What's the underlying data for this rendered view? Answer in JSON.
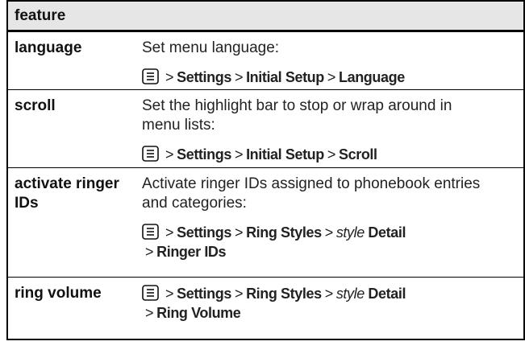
{
  "header": {
    "label": "feature"
  },
  "rows": [
    {
      "label": "language",
      "description": "Set menu language:",
      "path": [
        {
          "kind": "icon",
          "text": "menu-key-icon"
        },
        {
          "kind": "sep",
          "text": ">"
        },
        {
          "kind": "item",
          "text": "Settings"
        },
        {
          "kind": "sep",
          "text": ">"
        },
        {
          "kind": "item",
          "text": "Initial Setup"
        },
        {
          "kind": "sep",
          "text": ">"
        },
        {
          "kind": "item",
          "text": "Language"
        }
      ]
    },
    {
      "label": "scroll",
      "description": "Set the highlight bar to stop or wrap around in menu lists:",
      "path": [
        {
          "kind": "icon",
          "text": "menu-key-icon"
        },
        {
          "kind": "sep",
          "text": ">"
        },
        {
          "kind": "item",
          "text": "Settings"
        },
        {
          "kind": "sep",
          "text": ">"
        },
        {
          "kind": "item",
          "text": "Initial Setup"
        },
        {
          "kind": "sep",
          "text": ">"
        },
        {
          "kind": "item",
          "text": "Scroll"
        }
      ]
    },
    {
      "label": "activate ringer IDs",
      "description": "Activate ringer IDs assigned to phonebook entries and categories:",
      "path": [
        {
          "kind": "icon",
          "text": "menu-key-icon"
        },
        {
          "kind": "sep",
          "text": ">"
        },
        {
          "kind": "item",
          "text": "Settings"
        },
        {
          "kind": "sep",
          "text": ">"
        },
        {
          "kind": "item",
          "text": "Ring Styles"
        },
        {
          "kind": "sep",
          "text": ">"
        },
        {
          "kind": "italic",
          "text": "style"
        },
        {
          "kind": "item",
          "text": " Detail"
        },
        {
          "kind": "break",
          "text": ""
        },
        {
          "kind": "sep",
          "text": ">"
        },
        {
          "kind": "item",
          "text": "Ringer IDs"
        }
      ]
    },
    {
      "label": "ring volume",
      "description": "",
      "path": [
        {
          "kind": "icon",
          "text": "menu-key-icon"
        },
        {
          "kind": "sep",
          "text": ">"
        },
        {
          "kind": "item",
          "text": "Settings"
        },
        {
          "kind": "sep",
          "text": ">"
        },
        {
          "kind": "item",
          "text": "Ring Styles"
        },
        {
          "kind": "sep",
          "text": ">"
        },
        {
          "kind": "italic",
          "text": "style"
        },
        {
          "kind": "item",
          "text": " Detail"
        },
        {
          "kind": "break",
          "text": ""
        },
        {
          "kind": "sep",
          "text": ">"
        },
        {
          "kind": "item",
          "text": "Ring Volume"
        }
      ]
    }
  ]
}
